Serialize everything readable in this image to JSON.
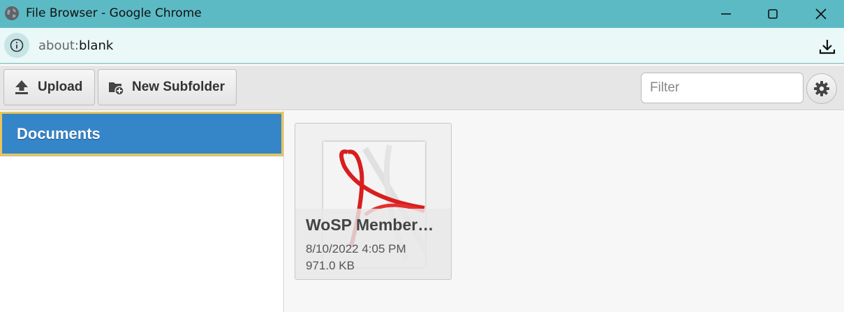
{
  "window": {
    "title": "File Browser - Google Chrome"
  },
  "address_bar": {
    "url_scheme": "about:",
    "url_rest": "blank"
  },
  "toolbar": {
    "upload_label": "Upload",
    "new_subfolder_label": "New Subfolder",
    "filter_placeholder": "Filter"
  },
  "sidebar": {
    "folders": [
      {
        "label": "Documents",
        "selected": true
      }
    ]
  },
  "files": [
    {
      "name": "WoSP Member…",
      "modified": "8/10/2022 4:05 PM",
      "size": "971.0 KB",
      "icon": "pdf-icon"
    }
  ],
  "colors": {
    "titlebar": "#5cbac4",
    "selected_folder": "#3585c9",
    "selected_folder_border": "#e8c65a"
  }
}
